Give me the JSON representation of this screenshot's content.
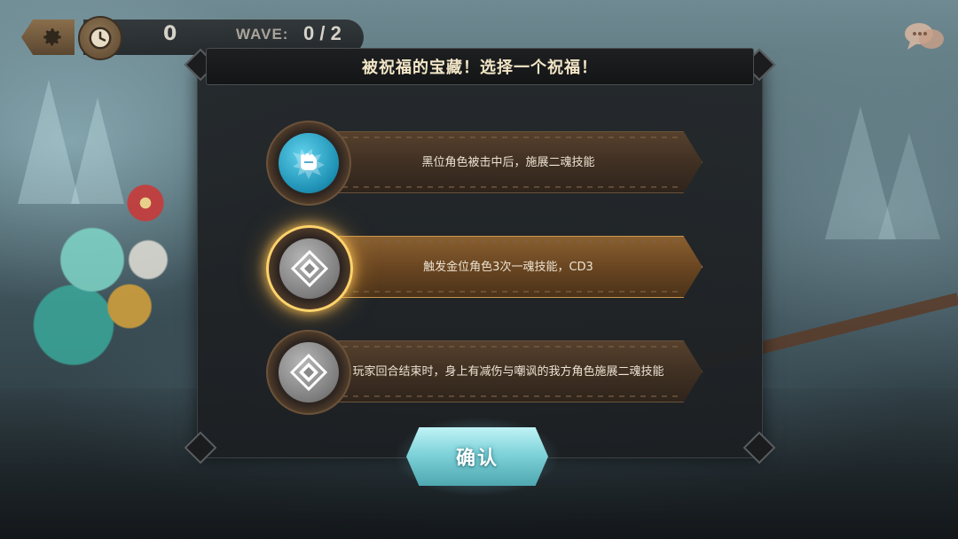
{
  "hud": {
    "settings_icon": "gear-icon",
    "timer_icon": "clock-icon",
    "timer_value": "0",
    "wave_label": "WAVE:",
    "wave_value": "0 / 2",
    "chat_icon": "chat-bubbles-icon"
  },
  "modal": {
    "title": "被祝福的宝藏！选择一个祝福！",
    "blessings": [
      {
        "icon": "fist-icon",
        "text": "黑位角色被击中后，施展二魂技能",
        "selected": false
      },
      {
        "icon": "diamond-emblem-icon",
        "text": "触发金位角色3次一魂技能，CD3",
        "selected": true
      },
      {
        "icon": "diamond-emblem-icon",
        "text": "玩家回合结束时，身上有减伤与嘲讽的我方角色施展二魂技能",
        "selected": false
      }
    ],
    "confirm_label": "确认"
  },
  "colors": {
    "accent_gold": "#ffd36b",
    "confirm_teal": "#7fd3d9",
    "title_text": "#f2e6c6"
  }
}
